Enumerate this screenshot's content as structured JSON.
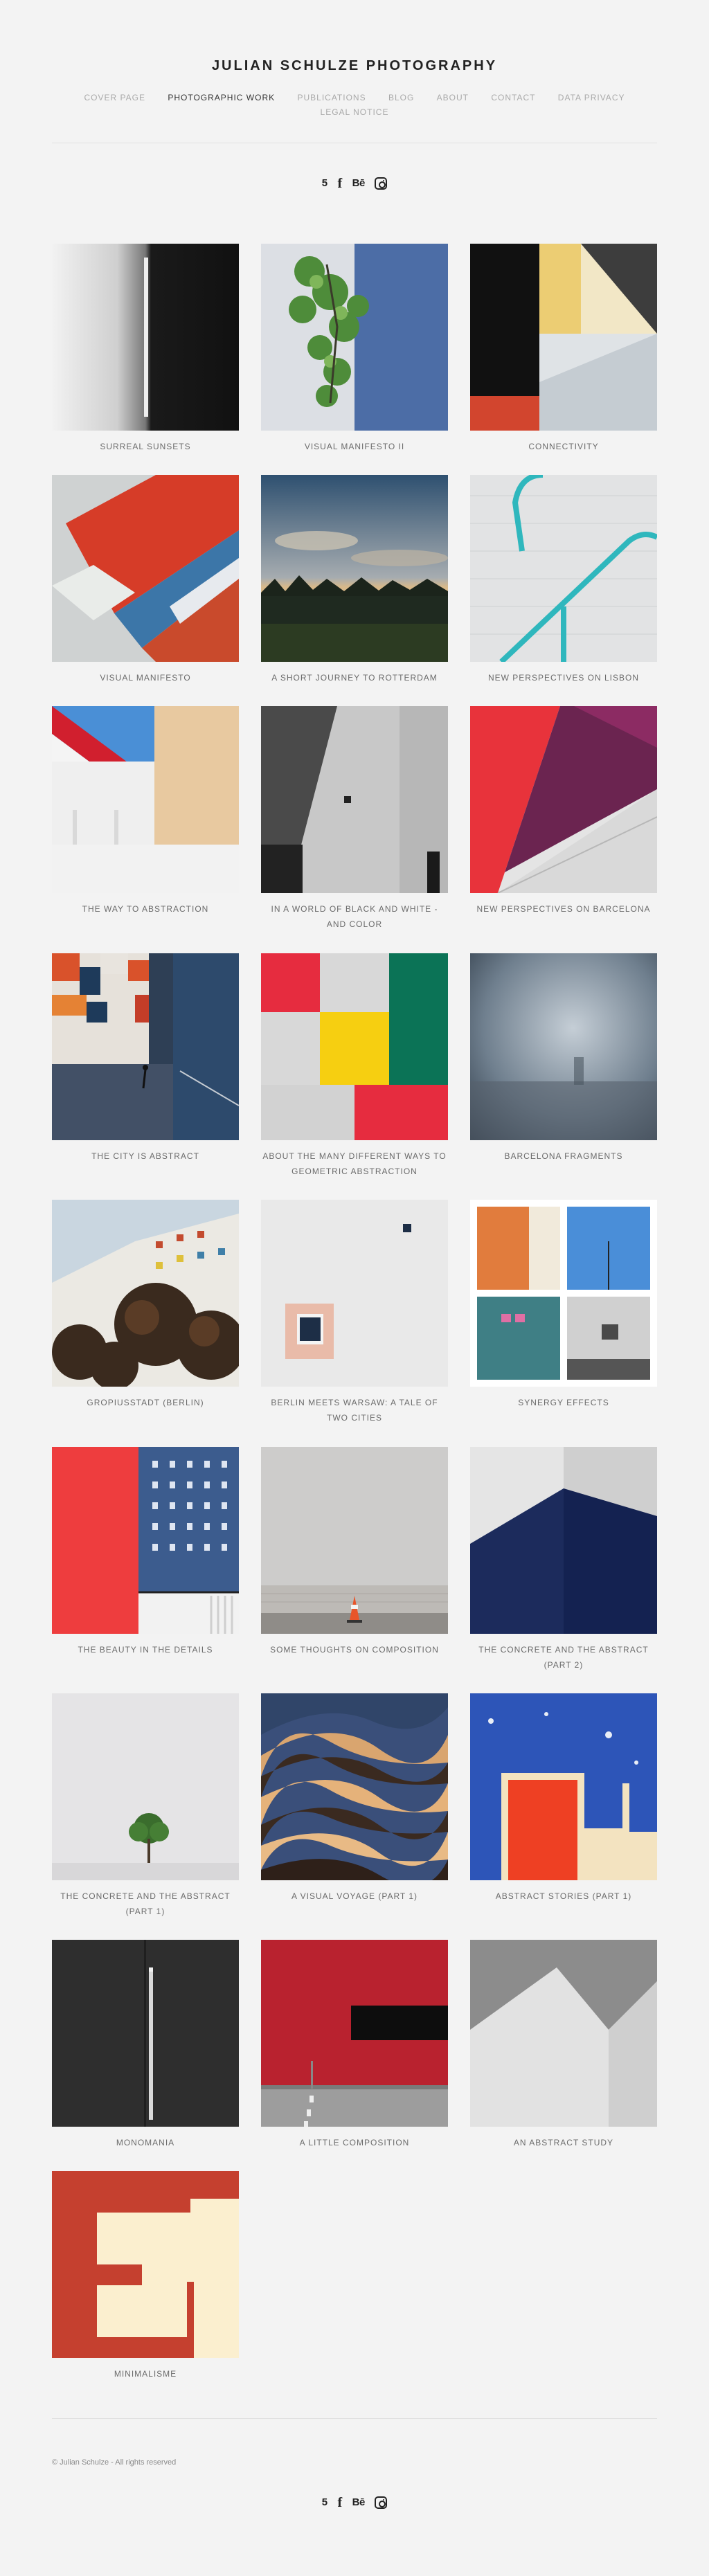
{
  "site": {
    "title": "JULIAN SCHULZE PHOTOGRAPHY"
  },
  "nav": {
    "row1": [
      "COVER PAGE",
      "PHOTOGRAPHIC WORK",
      "PUBLICATIONS",
      "BLOG",
      "ABOUT",
      "CONTACT",
      "DATA PRIVACY"
    ],
    "row2": [
      "LEGAL NOTICE"
    ],
    "active": "PHOTOGRAPHIC WORK"
  },
  "social": {
    "icons": [
      "500px-icon",
      "facebook-icon",
      "behance-icon",
      "instagram-icon"
    ],
    "labels": {
      "p500": "5",
      "facebook": "f",
      "behance": "Bē"
    }
  },
  "gallery": [
    {
      "caption": "SURREAL SUNSETS"
    },
    {
      "caption": "VISUAL MANIFESTO II"
    },
    {
      "caption": "CONNECTIVITY"
    },
    {
      "caption": "VISUAL MANIFESTO"
    },
    {
      "caption": "A SHORT JOURNEY TO ROTTERDAM"
    },
    {
      "caption": "NEW PERSPECTIVES ON LISBON"
    },
    {
      "caption": "THE WAY TO ABSTRACTION"
    },
    {
      "caption": "IN A WORLD OF BLACK AND WHITE - AND COLOR"
    },
    {
      "caption": "NEW PERSPECTIVES ON BARCELONA"
    },
    {
      "caption": "THE CITY IS ABSTRACT"
    },
    {
      "caption": "ABOUT THE MANY DIFFERENT WAYS TO GEOMETRIC ABSTRACTION"
    },
    {
      "caption": "BARCELONA FRAGMENTS"
    },
    {
      "caption": "GROPIUSSTADT (BERLIN)"
    },
    {
      "caption": "BERLIN MEETS WARSAW: A TALE OF TWO CITIES"
    },
    {
      "caption": "SYNERGY EFFECTS"
    },
    {
      "caption": "THE BEAUTY IN THE DETAILS"
    },
    {
      "caption": "SOME THOUGHTS ON COMPOSITION"
    },
    {
      "caption": "THE CONCRETE AND THE ABSTRACT (PART 2)"
    },
    {
      "caption": "THE CONCRETE AND THE ABSTRACT (PART 1)"
    },
    {
      "caption": "A VISUAL VOYAGE (PART 1)"
    },
    {
      "caption": "ABSTRACT STORIES (PART 1)"
    },
    {
      "caption": "MONOMANIA"
    },
    {
      "caption": "A LITTLE COMPOSITION"
    },
    {
      "caption": "AN ABSTRACT STUDY"
    },
    {
      "caption": "MINIMALISME"
    }
  ],
  "footer": {
    "copyright": "© Julian Schulze - All rights reserved"
  },
  "colors": {
    "background": "#f3f3f3",
    "title": "#222222",
    "nav_inactive": "#a9a9a9",
    "nav_active": "#333333",
    "caption": "#6b6b6b"
  }
}
